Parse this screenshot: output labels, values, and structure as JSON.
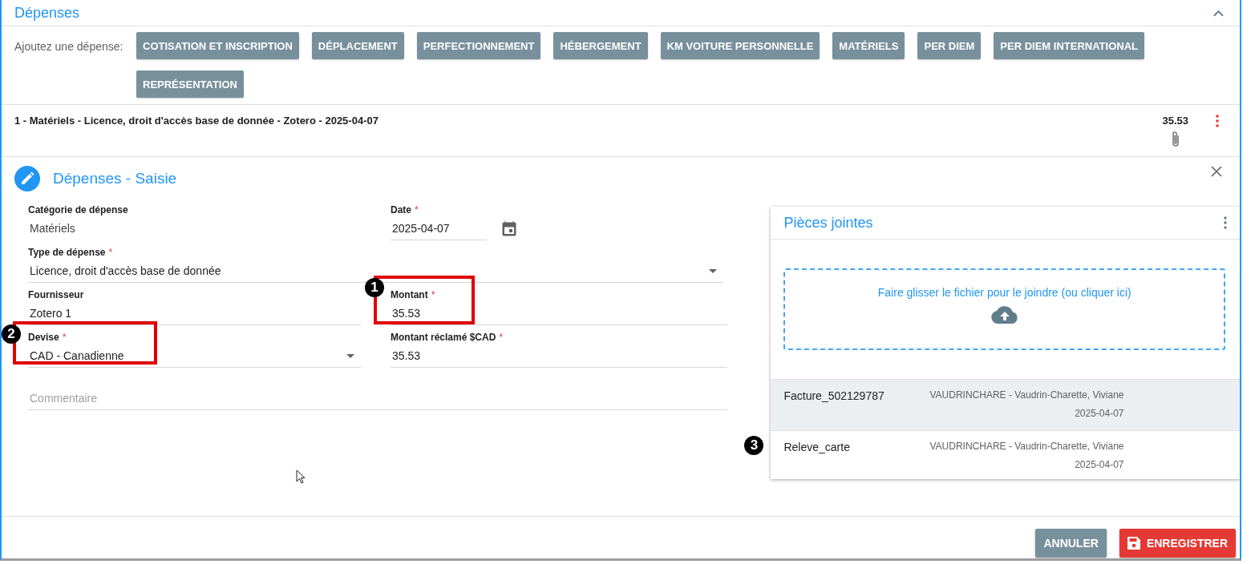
{
  "section": {
    "title": "Dépenses",
    "expanded": true
  },
  "add_bar": {
    "label": "Ajoutez une dépense:",
    "buttons": [
      "COTISATION ET INSCRIPTION",
      "DÉPLACEMENT",
      "PERFECTIONNEMENT",
      "HÉBERGEMENT",
      "KM VOITURE PERSONNELLE",
      "MATÉRIELS",
      "PER DIEM",
      "PER DIEM INTERNATIONAL",
      "REPRÉSENTATION"
    ]
  },
  "expense_items": [
    {
      "description": "1 - Matériels - Licence, droit d'accès base de donnée - Zotero - 2025-04-07",
      "amount": "35.53",
      "has_attachment": true
    }
  ],
  "editor": {
    "title": "Dépenses - Saisie",
    "fields": [
      {
        "kind": "static",
        "label": "Catégorie de dépense",
        "value": "Matériels"
      },
      {
        "kind": "date",
        "label": "Date",
        "required_mark": "*",
        "value": "2025-04-07"
      },
      {
        "kind": "wide_select",
        "label": "Type de dépense",
        "required_mark": "*",
        "value": "Licence, droit d'accès base de donnée"
      },
      {
        "kind": "text",
        "label": "Fournisseur",
        "value": "Zotero 1"
      },
      {
        "kind": "text",
        "label": "Montant",
        "required_mark": "*",
        "value": "35.53",
        "annotation": "1"
      },
      {
        "kind": "select",
        "label": "Devise",
        "required_mark": "*",
        "value": "CAD - Canadienne",
        "annotation": "2"
      },
      {
        "kind": "text",
        "label": "Montant réclamé $CAD",
        "required_mark": "*",
        "value": "35.53"
      },
      {
        "kind": "textarea",
        "placeholder": "Commentaire"
      }
    ],
    "attachments": {
      "title": "Pièces jointes",
      "dropzone": "Faire glisser le fichier pour le joindre (ou cliquer ici)",
      "files": [
        {
          "name": "Facture_502129787",
          "owner": "VAUDRINCHARE - Vaudrin-Charette, Viviane",
          "date": "2025-04-07",
          "selected": true
        },
        {
          "name": "Releve_carte",
          "owner": "VAUDRINCHARE - Vaudrin-Charette, Viviane",
          "date": "2025-04-07",
          "selected": false,
          "annotation": "3"
        }
      ]
    },
    "buttons": [
      {
        "kind": "cancel",
        "label": "ANNULER"
      },
      {
        "kind": "save",
        "label": "ENREGISTRER"
      }
    ]
  }
}
